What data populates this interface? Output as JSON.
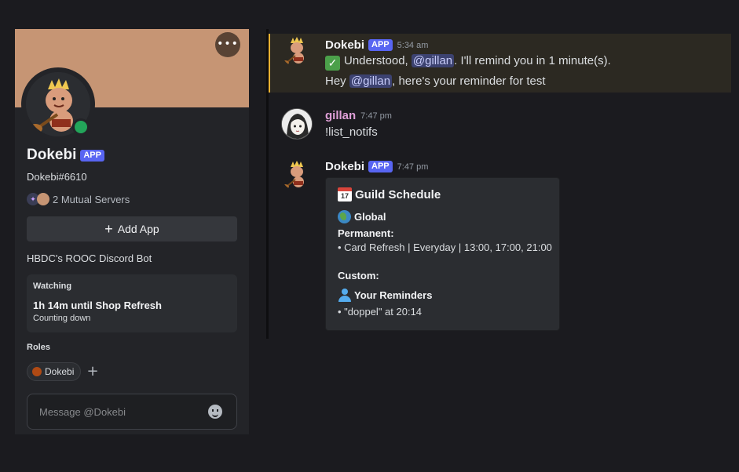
{
  "profile": {
    "name": "Dokebi",
    "badge": "APP",
    "tag": "Dokebi#6610",
    "mutual_servers": "2 Mutual Servers",
    "add_app_label": "Add App",
    "bio": "HBDC's ROOC Discord Bot",
    "activity": {
      "header": "Watching",
      "title": "1h 14m until Shop Refresh",
      "subtitle": "Counting down"
    },
    "roles_header": "Roles",
    "roles": [
      {
        "name": "Dokebi",
        "color": "#b04a14"
      }
    ],
    "message_placeholder": "Message @Dokebi",
    "banner_color": "#c69574",
    "status_color": "#23a55a"
  },
  "messages": [
    {
      "author": "Dokebi",
      "badge": "APP",
      "time": "5:34 am",
      "highlighted": true,
      "line1_before": "Understood, ",
      "line1_mention": "@gillan",
      "line1_after": ". I'll remind you in 1 minute(s).",
      "line2_before": "Hey ",
      "line2_mention": "@gillan",
      "line2_after": ", here's your reminder for test"
    },
    {
      "author": "gillan",
      "time": "7:47 pm",
      "text": "!list_notifs",
      "author_color": "#e0a0d8"
    },
    {
      "author": "Dokebi",
      "badge": "APP",
      "time": "7:47 pm",
      "embed": {
        "title": "Guild Schedule",
        "section_global": "Global",
        "permanent_label": "Permanent:",
        "permanent_item": "• Card Refresh | Everyday | 13:00, 17:00, 21:00",
        "custom_label": "Custom:",
        "section_reminders": "Your Reminders",
        "reminder_item": "• \"doppel\" at 20:14"
      }
    }
  ],
  "colors": {
    "accent": "#5865f2",
    "mention_bg": "#3c4270",
    "highlight_bar": "#f0b232"
  }
}
